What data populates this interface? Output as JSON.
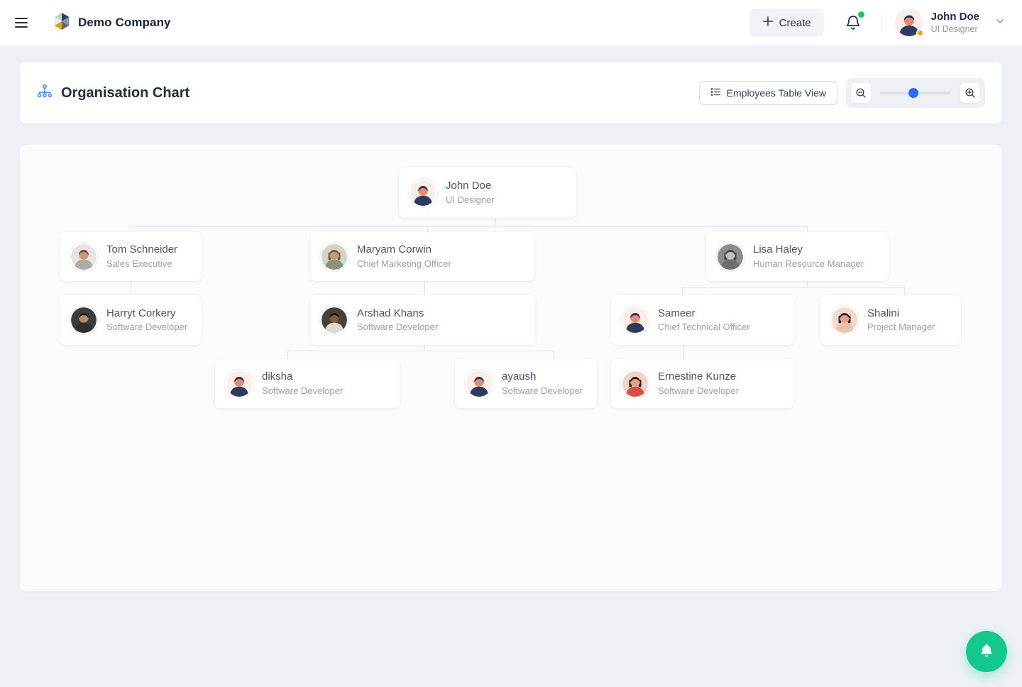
{
  "header": {
    "company_name": "Demo Company",
    "create_label": "Create",
    "notifications": {
      "unread_indicator": true,
      "dot_color": "#22c55e"
    },
    "user": {
      "name": "John Doe",
      "role": "UI Designer",
      "status_dot_color": "#e2a713"
    }
  },
  "toolbar": {
    "title": "Organisation Chart",
    "table_view_label": "Employees Table View",
    "zoom": {
      "thumb_position_percent": 47,
      "thumb_color": "#2d6bf2"
    }
  },
  "org_chart": {
    "nodes": [
      {
        "id": "john",
        "name": "John Doe",
        "title": "UI Designer",
        "manager": null,
        "avatar": {
          "bg": "#fbeee8",
          "skin": "#e98a6d",
          "hair": "#27335c",
          "shirt": "#2e3b5e",
          "hair_style": "short"
        }
      },
      {
        "id": "tom",
        "name": "Tom Schneider",
        "title": "Sales Executive",
        "manager": "john",
        "avatar": {
          "bg": "#e8e4df",
          "skin": "#c79a7a",
          "hair": "#6b5440",
          "shirt": "#b0aaa2",
          "hair_style": "short"
        }
      },
      {
        "id": "maryam",
        "name": "Maryam Corwin",
        "title": "Chief Marketing Officer",
        "manager": "john",
        "avatar": {
          "bg": "#cfd6c4",
          "skin": "#c89a7c",
          "hair": "#7a5c43",
          "shirt": "#8a9279",
          "hair_style": "long"
        }
      },
      {
        "id": "lisa",
        "name": "Lisa Haley",
        "title": "Human Resource Manager",
        "manager": "john",
        "avatar": {
          "bg": "#8c8c8c",
          "skin": "#c2c2c2",
          "hair": "#474747",
          "shirt": "#6e6e6e",
          "hair_style": "long"
        }
      },
      {
        "id": "harryt",
        "name": "Harryt Corkery",
        "title": "Software Developer",
        "manager": "tom",
        "avatar": {
          "bg": "#3d3d3d",
          "skin": "#b98a63",
          "hair": "#1c1c1c",
          "shirt": "#2f2f2f",
          "hair_style": "short"
        }
      },
      {
        "id": "arshad",
        "name": "Arshad Khans",
        "title": "Software Developer",
        "manager": "maryam",
        "avatar": {
          "bg": "#4a4038",
          "skin": "#8a5c3b",
          "hair": "#161616",
          "shirt": "#dcd9d4",
          "hair_style": "short"
        }
      },
      {
        "id": "sameer",
        "name": "Sameer",
        "title": "Chief Technical Officer",
        "manager": "lisa",
        "avatar": {
          "bg": "#fbeee8",
          "skin": "#e98a6d",
          "hair": "#27335c",
          "shirt": "#2e3b5e",
          "hair_style": "short"
        }
      },
      {
        "id": "shalini",
        "name": "Shalini",
        "title": "Project Manager",
        "manager": "lisa",
        "avatar": {
          "bg": "#f7d9c8",
          "skin": "#e7a084",
          "hair": "#232c45",
          "shirt": "#eac3b0",
          "hair_style": "long"
        }
      },
      {
        "id": "diksha",
        "name": "diksha",
        "title": "Software Developer",
        "manager": "arshad",
        "avatar": {
          "bg": "#fbeee8",
          "skin": "#e98a6d",
          "hair": "#27335c",
          "shirt": "#2e3b5e",
          "hair_style": "short"
        }
      },
      {
        "id": "ayaush",
        "name": "ayaush",
        "title": "Software Developer",
        "manager": "arshad",
        "avatar": {
          "bg": "#fbeee8",
          "skin": "#e98a6d",
          "hair": "#27335c",
          "shirt": "#2e3b5e",
          "hair_style": "short"
        }
      },
      {
        "id": "ernestine",
        "name": "Ernestine Kunze",
        "title": "Software Developer",
        "manager": "sameer",
        "avatar": {
          "bg": "#f3d3c8",
          "skin": "#e9a184",
          "hair": "#2b2420",
          "shirt": "#d94f43",
          "hair_style": "long"
        }
      }
    ]
  },
  "fab": {
    "icon": "bell-icon",
    "color": "#12c88c"
  },
  "icons": {
    "menu-icon": "hamburger bars",
    "logo-cube-icon": "faceted hex cube",
    "plus-icon": "+",
    "bell-icon": "bell outline",
    "chevron-down-icon": "v",
    "org-chart-icon": "hierarchy nodes",
    "list-icon": "bulleted list",
    "zoom-out-icon": "magnifier minus",
    "zoom-in-icon": "magnifier plus"
  },
  "colors": {
    "page_bg": "#edf1f6",
    "canvas_bg": "#fafbfc",
    "accent_blue": "#2d6bf2",
    "org_icon_blue": "#5b82f0",
    "fab_green": "#12c88c",
    "connector": "#e1e5e9"
  }
}
